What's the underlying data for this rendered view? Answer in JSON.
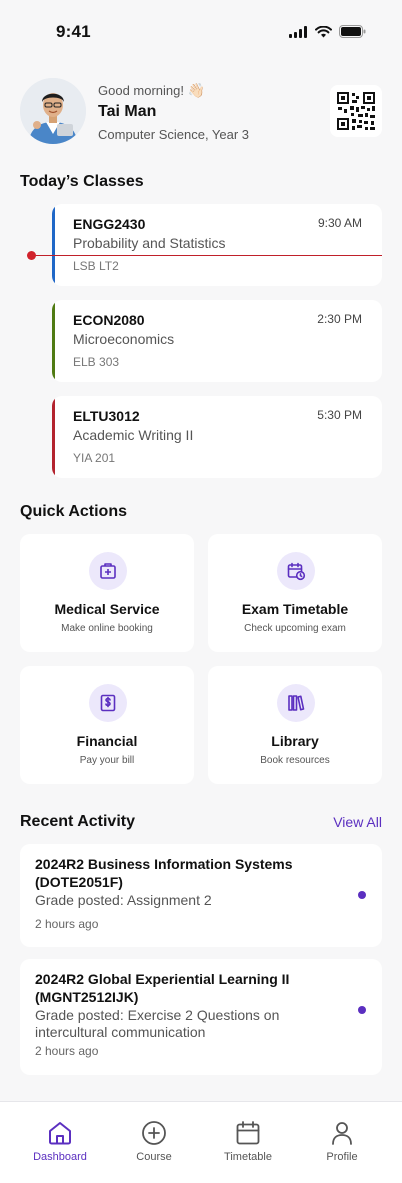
{
  "status_bar": {
    "time": "9:41"
  },
  "profile": {
    "greeting": "Good morning!",
    "wave_emoji": "👋🏻",
    "name": "Tai Man",
    "program": "Computer Science, Year 3"
  },
  "sections": {
    "today": "Today’s Classes",
    "quick_actions": "Quick Actions",
    "recent_activity": "Recent Activity",
    "view_all": "View All"
  },
  "classes": [
    {
      "code": "ENGG2430",
      "time": "9:30 AM",
      "name": "Probability and Statistics",
      "room": "LSB LT2",
      "color": "#1f67c7"
    },
    {
      "code": "ECON2080",
      "time": "2:30 PM",
      "name": "Microeconomics",
      "room": "ELB 303",
      "color": "#4f7a12"
    },
    {
      "code": "ELTU3012",
      "time": "5:30 PM",
      "name": "Academic Writing II",
      "room": "YIA 201",
      "color": "#b3232e"
    }
  ],
  "quick_actions": [
    {
      "title": "Medical Service",
      "subtitle": "Make online booking",
      "icon": "medical-icon"
    },
    {
      "title": "Exam Timetable",
      "subtitle": "Check upcoming exam",
      "icon": "calendar-clock-icon"
    },
    {
      "title": "Financial",
      "subtitle": "Pay your bill",
      "icon": "receipt-dollar-icon"
    },
    {
      "title": "Library",
      "subtitle": "Book resources",
      "icon": "books-icon"
    }
  ],
  "activity": [
    {
      "title": "2024R2 Business Information Systems (DOTE2051F)",
      "detail": "Grade posted: Assignment 2",
      "time": "2 hours ago"
    },
    {
      "title": "2024R2 Global Experiential Learning II (MGNT2512IJK)",
      "detail": "Grade posted: Exercise 2 Questions on intercultural communication",
      "time": "2 hours ago"
    }
  ],
  "nav": [
    {
      "label": "Dashboard",
      "icon": "home-icon",
      "active": true
    },
    {
      "label": "Course",
      "icon": "plus-circle-icon",
      "active": false
    },
    {
      "label": "Timetable",
      "icon": "calendar-icon",
      "active": false
    },
    {
      "label": "Profile",
      "icon": "user-icon",
      "active": false
    }
  ],
  "colors": {
    "accent": "#5b2fc0",
    "now_line": "#c0202a",
    "icon_bg": "#ece8fb"
  }
}
